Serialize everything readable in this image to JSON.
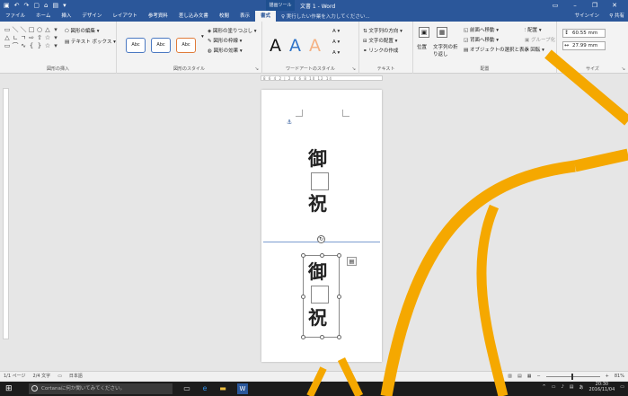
{
  "titlebar": {
    "quick_access_icons": [
      "save-icon",
      "undo-icon",
      "redo-icon",
      "new-icon",
      "open-icon",
      "print-preview-icon",
      "customize-icon"
    ],
    "context_tab": "描画ツール",
    "doc_title": "文書 1 - Word",
    "controls": [
      "ribbon-display-icon",
      "minimize-icon",
      "restore-icon",
      "close-icon"
    ]
  },
  "tabs": [
    "ファイル",
    "ホーム",
    "挿入",
    "デザイン",
    "レイアウト",
    "参考資料",
    "差し込み文書",
    "校閲",
    "表示",
    "書式"
  ],
  "active_tab": "書式",
  "tell_me": "実行したい作業を入力してください...",
  "signin": "サインイン",
  "share": "共有",
  "ribbon": {
    "insert_shapes": {
      "label": "図形の挿入",
      "edit_shape": "図形の編集",
      "text_box": "テキスト ボックス"
    },
    "shape_styles": {
      "label": "図形のスタイル",
      "styles": [
        "Abc",
        "Abc",
        "Abc"
      ],
      "fill": "図形の塗りつぶし",
      "outline": "図形の枠線",
      "effects": "図形の効果"
    },
    "wordart_styles": {
      "label": "ワードアートのスタイル",
      "letters": [
        "A",
        "A",
        "A"
      ]
    },
    "text": {
      "label": "テキスト",
      "direction": "文字列の方向",
      "align": "文字の配置",
      "link": "リンクの作成"
    },
    "arrange": {
      "label": "配置",
      "position": "位置",
      "wrap": "文字列の折り返し",
      "bring_forward": "前面へ移動",
      "send_backward": "背面へ移動",
      "selection_pane": "オブジェクトの選択と表示",
      "align": "配置",
      "group": "グループ化",
      "rotate": "回転"
    },
    "size": {
      "label": "サイズ",
      "height": "60.55 mm",
      "width": "27.99 mm"
    }
  },
  "ruler_scale": "8 6 4 2 | 2 4 6 8 10 12 14",
  "page": {
    "top_text": [
      "御",
      "祝"
    ],
    "selected_text": [
      "御",
      "祝"
    ]
  },
  "status": {
    "page": "1/1 ページ",
    "words": "2/4 文字",
    "lang": "日本語",
    "zoom": "81%"
  },
  "taskbar": {
    "search_placeholder": "Cortanaに何か聞いてみてください。",
    "time": "20:30",
    "date": "2016/11/04",
    "ime": "あ"
  },
  "colors": {
    "accent": "#2b579a",
    "overlay": "#f5a800"
  }
}
